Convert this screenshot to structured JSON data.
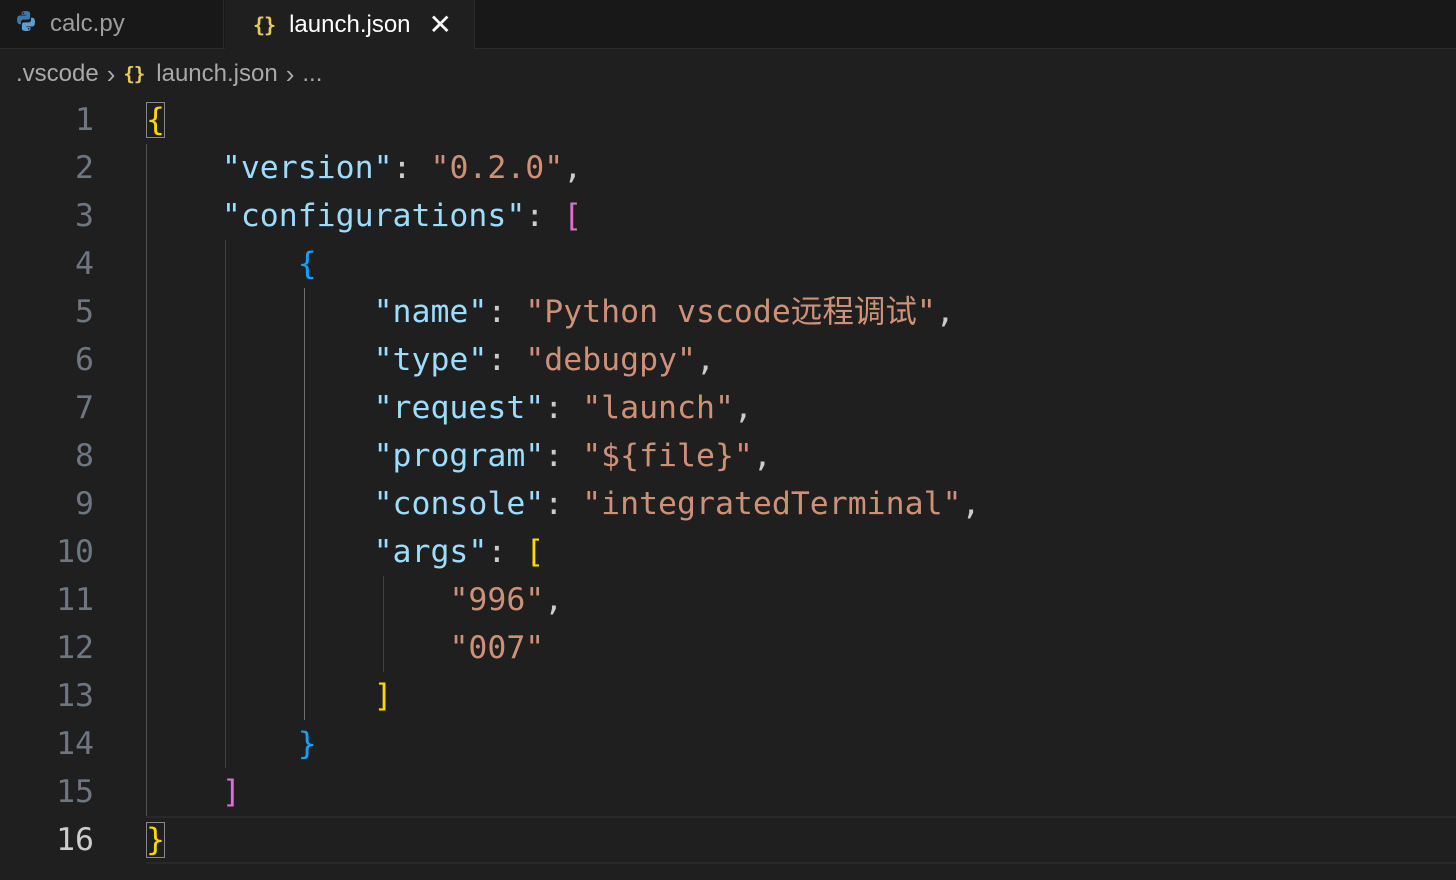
{
  "tabs": [
    {
      "label": "calc.py",
      "icon": "python-icon",
      "active": false
    },
    {
      "label": "launch.json",
      "icon": "json-braces-icon",
      "active": true,
      "close": "✕"
    }
  ],
  "breadcrumb": {
    "folder": ".vscode",
    "file": "launch.json",
    "more": "...",
    "separator": "›",
    "file_icon": "{}"
  },
  "editor": {
    "current_line": 16,
    "lines": [
      {
        "n": "1",
        "tokens": [
          {
            "t": "{",
            "c": "b1 match"
          }
        ]
      },
      {
        "n": "2",
        "tokens": [
          {
            "t": "    "
          },
          {
            "t": "\"version\"",
            "c": "k"
          },
          {
            "t": ": ",
            "c": "p"
          },
          {
            "t": "\"0.2.0\"",
            "c": "s"
          },
          {
            "t": ",",
            "c": "p"
          }
        ]
      },
      {
        "n": "3",
        "tokens": [
          {
            "t": "    "
          },
          {
            "t": "\"configurations\"",
            "c": "k"
          },
          {
            "t": ": ",
            "c": "p"
          },
          {
            "t": "[",
            "c": "b2"
          }
        ]
      },
      {
        "n": "4",
        "tokens": [
          {
            "t": "        "
          },
          {
            "t": "{",
            "c": "b3"
          }
        ]
      },
      {
        "n": "5",
        "tokens": [
          {
            "t": "            "
          },
          {
            "t": "\"name\"",
            "c": "k"
          },
          {
            "t": ": ",
            "c": "p"
          },
          {
            "t": "\"Python vscode远程调试\"",
            "c": "s"
          },
          {
            "t": ",",
            "c": "p"
          }
        ]
      },
      {
        "n": "6",
        "tokens": [
          {
            "t": "            "
          },
          {
            "t": "\"type\"",
            "c": "k"
          },
          {
            "t": ": ",
            "c": "p"
          },
          {
            "t": "\"debugpy\"",
            "c": "s"
          },
          {
            "t": ",",
            "c": "p"
          }
        ]
      },
      {
        "n": "7",
        "tokens": [
          {
            "t": "            "
          },
          {
            "t": "\"request\"",
            "c": "k"
          },
          {
            "t": ": ",
            "c": "p"
          },
          {
            "t": "\"launch\"",
            "c": "s"
          },
          {
            "t": ",",
            "c": "p"
          }
        ]
      },
      {
        "n": "8",
        "tokens": [
          {
            "t": "            "
          },
          {
            "t": "\"program\"",
            "c": "k"
          },
          {
            "t": ": ",
            "c": "p"
          },
          {
            "t": "\"${file}\"",
            "c": "s"
          },
          {
            "t": ",",
            "c": "p"
          }
        ]
      },
      {
        "n": "9",
        "tokens": [
          {
            "t": "            "
          },
          {
            "t": "\"console\"",
            "c": "k"
          },
          {
            "t": ": ",
            "c": "p"
          },
          {
            "t": "\"integratedTerminal\"",
            "c": "s"
          },
          {
            "t": ",",
            "c": "p"
          }
        ]
      },
      {
        "n": "10",
        "tokens": [
          {
            "t": "            "
          },
          {
            "t": "\"args\"",
            "c": "k"
          },
          {
            "t": ": ",
            "c": "p"
          },
          {
            "t": "[",
            "c": "b1"
          }
        ]
      },
      {
        "n": "11",
        "tokens": [
          {
            "t": "                "
          },
          {
            "t": "\"996\"",
            "c": "s"
          },
          {
            "t": ",",
            "c": "p"
          }
        ]
      },
      {
        "n": "12",
        "tokens": [
          {
            "t": "                "
          },
          {
            "t": "\"007\"",
            "c": "s"
          }
        ]
      },
      {
        "n": "13",
        "tokens": [
          {
            "t": "            "
          },
          {
            "t": "]",
            "c": "b1"
          }
        ]
      },
      {
        "n": "14",
        "tokens": [
          {
            "t": "        "
          },
          {
            "t": "}",
            "c": "b3"
          }
        ]
      },
      {
        "n": "15",
        "tokens": [
          {
            "t": "    "
          },
          {
            "t": "]",
            "c": "b2"
          }
        ]
      },
      {
        "n": "16",
        "tokens": [
          {
            "t": "}",
            "c": "b1 match"
          }
        ]
      }
    ]
  },
  "colors": {
    "background": "#1f1f1f",
    "key": "#9cdcfe",
    "string": "#ce9178",
    "bracket_level1": "#ffd700",
    "bracket_level2": "#da70d6",
    "bracket_level3": "#179fff",
    "json_icon": "#e8c95b"
  }
}
